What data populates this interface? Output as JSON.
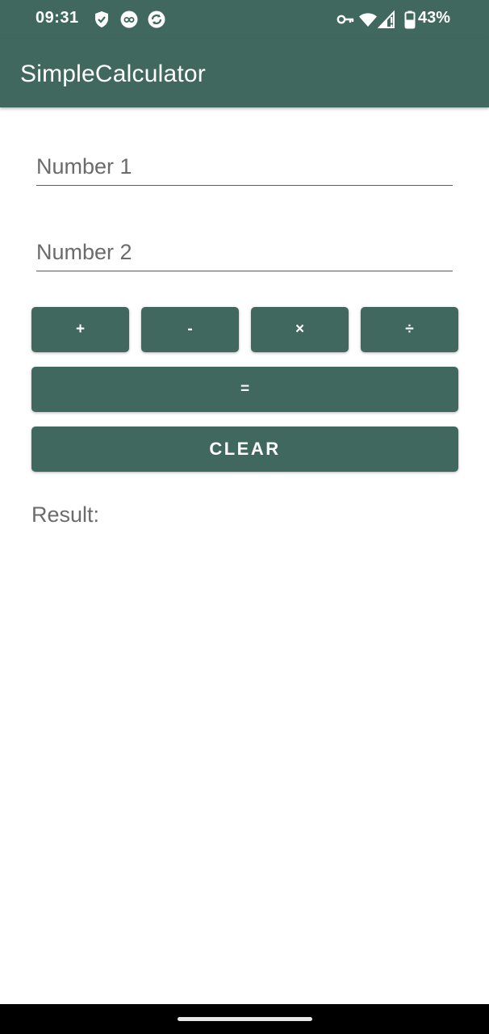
{
  "status_bar": {
    "time": "09:31",
    "left_icons": [
      "shield-icon",
      "vpn-app-icon",
      "sync-icon"
    ],
    "right_icons": [
      "key-icon",
      "wifi-icon",
      "signal-icon",
      "battery-icon"
    ],
    "battery_percent": "43%"
  },
  "app_bar": {
    "title": "SimpleCalculator"
  },
  "form": {
    "number1_placeholder": "Number 1",
    "number2_placeholder": "Number 2"
  },
  "operators": {
    "plus": "+",
    "minus": "-",
    "times": "×",
    "divide": "÷"
  },
  "equals_label": "=",
  "clear_label": "CLEAR",
  "result_label": "Result:",
  "colors": {
    "primary": "#40685e",
    "on_primary": "#ffffff",
    "background": "#ffffff",
    "hint_text": "#6b6b6b"
  }
}
